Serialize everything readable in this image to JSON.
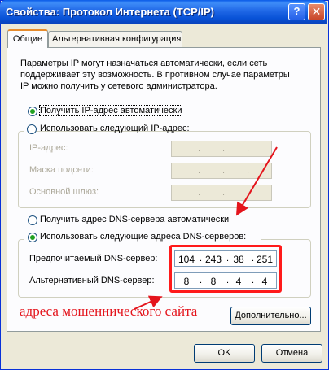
{
  "window": {
    "title": "Свойства: Протокол Интернета (TCP/IP)",
    "help_label": "?",
    "close_label": "✕"
  },
  "tabs": [
    {
      "label": "Общие",
      "active": true
    },
    {
      "label": "Альтернативная конфигурация",
      "active": false
    }
  ],
  "description": "Параметры IP могут назначаться автоматически, если сеть поддерживает эту возможность. В противном случае параметры IP можно получить у сетевого администратора.",
  "ip": {
    "auto_label": "Получить IP-адрес автоматически",
    "manual_label": "Использовать следующий IP-адрес:",
    "auto_selected": true,
    "fields": [
      {
        "label": "IP-адрес:"
      },
      {
        "label": "Маска подсети:"
      },
      {
        "label": "Основной шлюз:"
      }
    ]
  },
  "dns": {
    "auto_label": "Получить адрес DNS-сервера автоматически",
    "manual_label": "Использовать следующие адреса DNS-серверов:",
    "manual_selected": true,
    "preferred_label": "Предпочитаемый DNS-сервер:",
    "preferred": [
      "104",
      "243",
      "38",
      "251"
    ],
    "alternate_label": "Альтернативный DNS-сервер:",
    "alternate": [
      "8",
      "8",
      "4",
      "4"
    ]
  },
  "annotation": "адреса мошеннического сайта",
  "buttons": {
    "advanced": "Дополнительно...",
    "ok": "OK",
    "cancel": "Отмена"
  },
  "colors": {
    "title_bar": "#0a5be8",
    "annotation": "#e4141c",
    "highlight_box": "#ff1a1a"
  }
}
